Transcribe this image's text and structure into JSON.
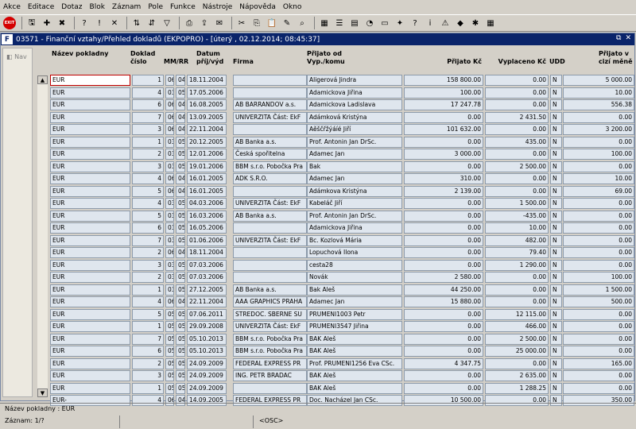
{
  "menu": [
    "Akce",
    "Editace",
    "Dotaz",
    "Blok",
    "Záznam",
    "Pole",
    "Funkce",
    "Nástroje",
    "Nápověda",
    "Okno"
  ],
  "window": {
    "title": "03571 - Finanční vztahy/Přehled dokladů (EKPOPRO) - [úterý , 02.12.2014; 08:45:37]"
  },
  "nav": {
    "label": "Nav"
  },
  "headers": {
    "nazev": "Název pokladny",
    "doklad": "Doklad číslo",
    "mmrr": "MM/RR",
    "datum": "Datum příj/výd",
    "firma": "Firma",
    "prijato_od": "Přijato od Vyp./komu",
    "prijato_kc": "Přijato Kč",
    "vyplaceno": "Vyplaceno Kč",
    "udd": "UDD",
    "prijato_cizi": "Přijato v cizí měně"
  },
  "rows": [
    [
      "EUR",
      "1",
      "06",
      "04",
      "18.11.2004",
      "",
      "Aligerová Jindra",
      "158 800.00",
      "0.00",
      "N",
      "5 000.00"
    ],
    [
      "EUR",
      "4",
      "03",
      "05",
      "17.05.2006",
      "",
      "Adamickova Jiřina",
      "100.00",
      "0.00",
      "N",
      "10.00"
    ],
    [
      "EUR",
      "6",
      "06",
      "04",
      "16.08.2005",
      "AB BARRANDOV a.s.",
      "Adamickova Ladislava",
      "17 247.78",
      "0.00",
      "N",
      "556.38"
    ],
    [
      "EUR",
      "7",
      "06",
      "04",
      "13.09.2005",
      "UNIVERZITA Část: EkF",
      "Adámková Kristýna",
      "0.00",
      "2 431.50",
      "N",
      "0.00"
    ],
    [
      "EUR",
      "3",
      "06",
      "04",
      "22.11.2004",
      "",
      "Aěščřžýáíé Jiří",
      "101 632.00",
      "0.00",
      "N",
      "3 200.00"
    ],
    [
      "EUR",
      "1",
      "03",
      "05",
      "20.12.2005",
      "AB Banka a.s.",
      "Prof. Antonin Jan DrSc.",
      "0.00",
      "435.00",
      "N",
      "0.00"
    ],
    [
      "EUR",
      "2",
      "03",
      "05",
      "12.01.2006",
      "Česká spořitelna",
      "Adamec Jan",
      "3 000.00",
      "0.00",
      "N",
      "100.00"
    ],
    [
      "EUR",
      "3",
      "03",
      "05",
      "19.01.2006",
      "BBM s.r.o. Pobočka Pra",
      "Bak",
      "0.00",
      "2 500.00",
      "N",
      "0.00"
    ],
    [
      "EUR",
      "4",
      "06",
      "04",
      "16.01.2005",
      "ADK S.R.O.",
      "Adamec Jan",
      "310.00",
      "0.00",
      "N",
      "10.00"
    ],
    [
      "EUR",
      "5",
      "06",
      "04",
      "16.01.2005",
      "",
      "Adámkova Kristýna",
      "2 139.00",
      "0.00",
      "N",
      "69.00"
    ],
    [
      "EUR",
      "4",
      "03",
      "05",
      "04.03.2006",
      "UNIVERZITA Část: EkF",
      "Kabeláč Jiří",
      "0.00",
      "1 500.00",
      "N",
      "0.00"
    ],
    [
      "EUR",
      "5",
      "03",
      "05",
      "16.03.2006",
      "AB Banka a.s.",
      "Prof. Antonin Jan DrSc.",
      "0.00",
      "-435.00",
      "N",
      "0.00"
    ],
    [
      "EUR",
      "6",
      "03",
      "05",
      "16.05.2006",
      "",
      "Adamickova Jiřina",
      "0.00",
      "10.00",
      "N",
      "0.00"
    ],
    [
      "EUR",
      "7",
      "03",
      "05",
      "01.06.2006",
      "UNIVERZITA Část: EkF",
      "Bc. Kozlová Mária",
      "0.00",
      "482.00",
      "N",
      "0.00"
    ],
    [
      "EUR",
      "2",
      "06",
      "04",
      "18.11.2004",
      "",
      "Lopuchová Ilona",
      "0.00",
      "79.40",
      "N",
      "0.00"
    ],
    [
      "EUR",
      "3",
      "03",
      "05",
      "07.03.2006",
      "",
      "cesta28",
      "0.00",
      "1 290.00",
      "N",
      "0.00"
    ],
    [
      "EUR",
      "2",
      "03",
      "05",
      "07.03.2006",
      "",
      "Novák",
      "2 580.00",
      "0.00",
      "N",
      "100.00"
    ],
    [
      "EUR",
      "1",
      "03",
      "05",
      "27.12.2005",
      "AB Banka a.s.",
      "Bak Aleš",
      "44 250.00",
      "0.00",
      "N",
      "1 500.00"
    ],
    [
      "EUR",
      "4",
      "06",
      "04",
      "22.11.2004",
      "AAA GRAPHICS PRAHA",
      "Adamec Jan",
      "15 880.00",
      "0.00",
      "N",
      "500.00"
    ],
    [
      "EUR",
      "5",
      "05",
      "05",
      "07.06.2011",
      "STREDOC. SBERNE SU",
      "PRUMENI1003 Petr",
      "0.00",
      "12 115.00",
      "N",
      "0.00"
    ],
    [
      "EUR",
      "1",
      "05",
      "05",
      "29.09.2008",
      "UNIVERZITA Část: EkF",
      "PRUMENI3547 Jiřina",
      "0.00",
      "466.00",
      "N",
      "0.00"
    ],
    [
      "EUR",
      "7",
      "05",
      "05",
      "05.10.2013",
      "BBM s.r.o. Pobočka Pra",
      "BAK Aleš",
      "0.00",
      "2 500.00",
      "N",
      "0.00"
    ],
    [
      "EUR",
      "6",
      "05",
      "05",
      "05.10.2013",
      "BBM s.r.o. Pobočka Pra",
      "BAK Aleš",
      "0.00",
      "25 000.00",
      "N",
      "0.00"
    ],
    [
      "EUR",
      "2",
      "05",
      "05",
      "24.09.2009",
      "FEDERAL EXPRESS PR",
      "Prof. PRUMENI1256 Eva CSc.",
      "4 347.75",
      "0.00",
      "N",
      "165.00"
    ],
    [
      "EUR",
      "3",
      "05",
      "05",
      "24.09.2009",
      "ING. PETR BRADAC",
      "BAK Aleš",
      "0.00",
      "2 635.00",
      "N",
      "0.00"
    ],
    [
      "EUR",
      "1",
      "05",
      "05",
      "24.09.2009",
      "",
      "BAK Aleš",
      "0.00",
      "1 288.25",
      "N",
      "0.00"
    ],
    [
      "EUR-",
      "4",
      "06",
      "04",
      "14.09.2005",
      "FEDERAL EXPRESS PR",
      "Doc. Nacházel Jan CSc.",
      "10 500.00",
      "0.00",
      "N",
      "350.00"
    ]
  ],
  "status": {
    "field": "Název pokladny : EUR",
    "record": "Záznam: 1/?",
    "mode": "<OSC>"
  }
}
